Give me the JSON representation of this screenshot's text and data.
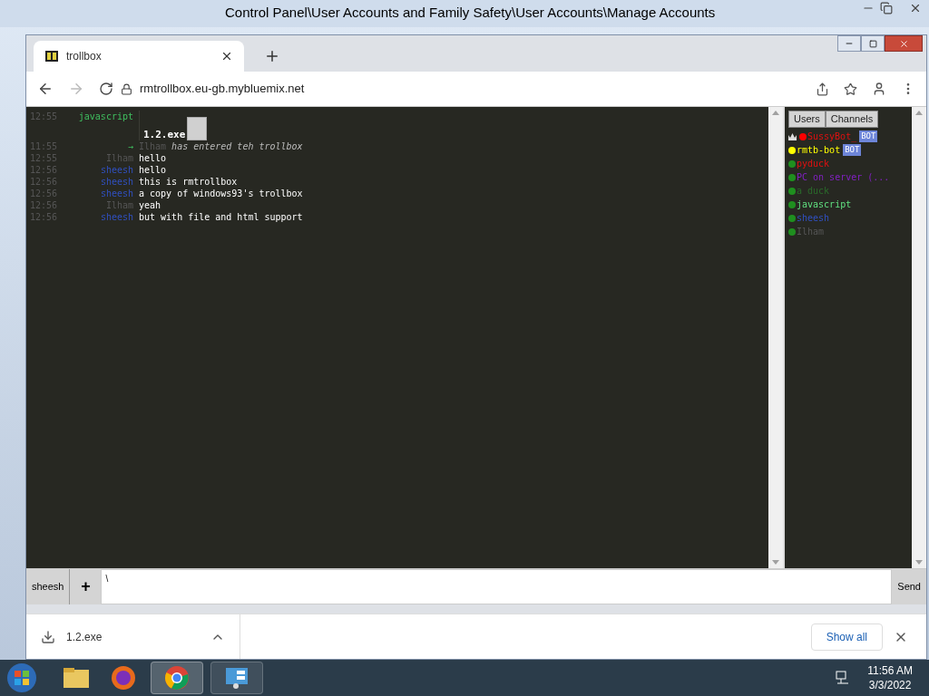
{
  "background_window": {
    "title": "Control Panel\\User Accounts and Family Safety\\User Accounts\\Manage Accounts"
  },
  "browser": {
    "tab": {
      "title": "trollbox"
    },
    "url": "rmtrollbox.eu-gb.mybluemix.net"
  },
  "chat": {
    "messages": [
      {
        "kind": "file",
        "time": "12:55",
        "nick": "javascript",
        "color": "#3fbf5f",
        "file": "1.2.exe"
      },
      {
        "kind": "join",
        "time": "11:55",
        "arrow": "→",
        "nick": "Ilham",
        "color": "#555555",
        "text": "has entered teh trollbox"
      },
      {
        "kind": "text",
        "time": "12:55",
        "nick": "Ilham",
        "color": "#555555",
        "text": "hello"
      },
      {
        "kind": "text",
        "time": "12:56",
        "nick": "sheesh",
        "color": "#3050c0",
        "text": "hello"
      },
      {
        "kind": "text",
        "time": "12:56",
        "nick": "sheesh",
        "color": "#3050c0",
        "text": "this is rmtrollbox"
      },
      {
        "kind": "text",
        "time": "12:56",
        "nick": "sheesh",
        "color": "#3050c0",
        "text": "a copy of windows93's trollbox"
      },
      {
        "kind": "text",
        "time": "12:56",
        "nick": "Ilham",
        "color": "#555555",
        "text": "yeah"
      },
      {
        "kind": "text",
        "time": "12:56",
        "nick": "sheesh",
        "color": "#3050c0",
        "text": "but with file and html support"
      }
    ],
    "panel_tabs": [
      {
        "label": "Users",
        "selected": false
      },
      {
        "label": "Channels",
        "selected": false
      }
    ],
    "users": [
      {
        "name": "SussyBot_",
        "color": "#e01010",
        "status": {
          "color": "#ff0000"
        },
        "bot": "BOT",
        "crown": true
      },
      {
        "name": "rmtb-bot",
        "color": "#ffff00",
        "status": {
          "color": "#ffff00"
        },
        "bot": "BOT",
        "crown": false
      },
      {
        "name": "pyduck",
        "color": "#e01010",
        "status": {
          "color": "#1f8f1f"
        },
        "crown": false
      },
      {
        "name": "PC on server (...",
        "color": "#8020c0",
        "status": {
          "color": "#1f8f1f"
        },
        "crown": false
      },
      {
        "name": "a duck",
        "color": "#2a6a2a",
        "status": {
          "color": "#1f8f1f"
        },
        "crown": false
      },
      {
        "name": "javascript",
        "color": "#60e080",
        "status": {
          "color": "#1f8f1f"
        },
        "crown": false
      },
      {
        "name": "sheesh",
        "color": "#3050c0",
        "status": {
          "color": "#1f8f1f"
        },
        "crown": false
      },
      {
        "name": "Ilham",
        "color": "#555555",
        "status": {
          "color": "#1f8f1f"
        },
        "crown": false
      }
    ],
    "input": {
      "nick": "sheesh",
      "plus": "+",
      "value": "\\",
      "send": "Send"
    }
  },
  "download_bar": {
    "file": "1.2.exe",
    "show_all": "Show all"
  },
  "taskbar": {
    "time": "11:56 AM",
    "date": "3/3/2022"
  }
}
